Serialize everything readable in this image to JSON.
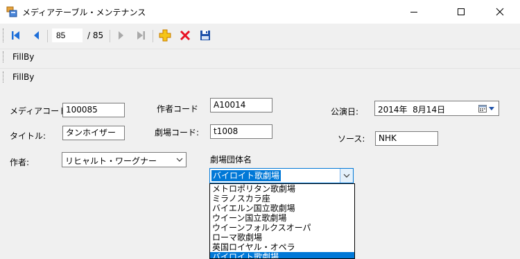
{
  "window": {
    "title": "メディアテーブル・メンテナンス"
  },
  "navigator": {
    "position": "85",
    "count": "/ 85"
  },
  "toolstrips": [
    {
      "label": "FillBy"
    },
    {
      "label": "FillBy"
    }
  ],
  "form": {
    "media_code": {
      "label": "メディアコード:",
      "value": "100085"
    },
    "title": {
      "label": "タイトル:",
      "value": "タンホイザー"
    },
    "author": {
      "label": "作者:",
      "value": "リヒャルト・ワーグナー"
    },
    "author_code": {
      "label": "作者コード",
      "value": "A10014"
    },
    "theater_code": {
      "label": "劇場コード:",
      "value": "t1008"
    },
    "theater_group": {
      "label": "劇場団体名",
      "value": "バイロイト歌劇場",
      "options": [
        "メトロポリタン歌劇場",
        "ミラノスカラ座",
        "バイエルン国立歌劇場",
        "ウイーン国立歌劇場",
        "ウイーンフォルクスオーパ",
        "ローマ歌劇場",
        "英国ロイヤル・オペラ",
        "バイロイト歌劇場"
      ],
      "selected_index": 7
    },
    "performance_date": {
      "label": "公演日:",
      "value": "2014年  8月14日"
    },
    "source": {
      "label": "ソース:",
      "value": "NHK"
    }
  },
  "colors": {
    "selection": "#0078d7",
    "delete_red": "#e81123",
    "nav_blue": "#1e6fd9"
  }
}
